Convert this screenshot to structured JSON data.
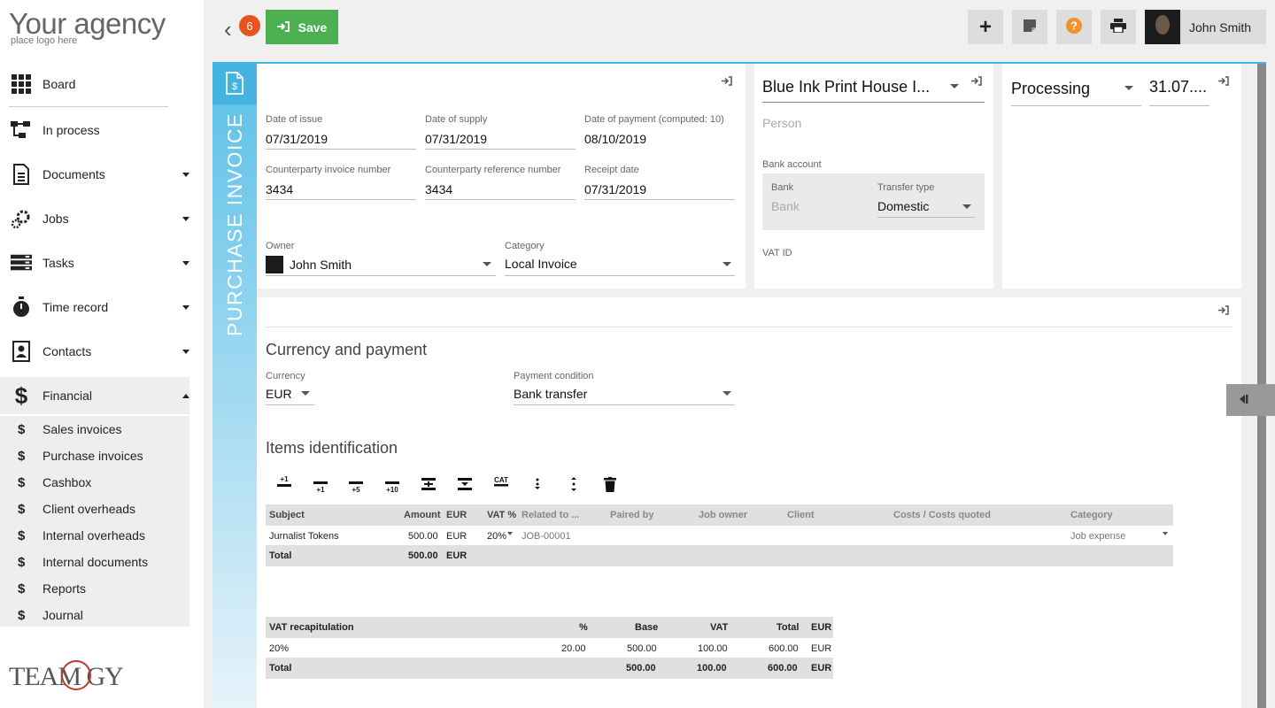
{
  "logo": {
    "main": "Your agency",
    "sub": "place logo here"
  },
  "brand": "TEAM GY",
  "nav": {
    "board": "Board",
    "in_process": "In process",
    "documents": "Documents",
    "jobs": "Jobs",
    "tasks": "Tasks",
    "time_record": "Time record",
    "contacts": "Contacts",
    "financial": "Financial"
  },
  "financial_sub": {
    "sales_invoices": "Sales invoices",
    "purchase_invoices": "Purchase invoices",
    "cashbox": "Cashbox",
    "client_overheads": "Client overheads",
    "internal_overheads": "Internal overheads",
    "internal_documents": "Internal documents",
    "reports": "Reports",
    "journal": "Journal"
  },
  "toolbar": {
    "badge_count": "6",
    "save_label": "Save",
    "user_name": "John Smith"
  },
  "document": {
    "type_title": "PURCHASE INVOICE"
  },
  "dates": {
    "issue_label": "Date of issue",
    "issue_value": "07/31/2019",
    "supply_label": "Date of supply",
    "supply_value": "07/31/2019",
    "payment_label": "Date of payment (computed: 10)",
    "payment_value": "08/10/2019",
    "cp_invoice_label": "Counterparty invoice number",
    "cp_invoice_value": "3434",
    "cp_ref_label": "Counterparty reference number",
    "cp_ref_value": "3434",
    "receipt_label": "Receipt date",
    "receipt_value": "07/31/2019",
    "owner_label": "Owner",
    "owner_value": "John Smith",
    "category_label": "Category",
    "category_value": "Local Invoice"
  },
  "counterparty": {
    "name": "Blue Ink Print House I...",
    "person_placeholder": "Person",
    "bank_account_label": "Bank account",
    "bank_label": "Bank",
    "bank_placeholder": "Bank",
    "transfer_label": "Transfer type",
    "transfer_value": "Domestic",
    "vat_label": "VAT ID"
  },
  "status": {
    "state": "Processing",
    "date": "31.07...."
  },
  "payment": {
    "section_title": "Currency and payment",
    "currency_label": "Currency",
    "currency_value": "EUR",
    "condition_label": "Payment condition",
    "condition_value": "Bank transfer"
  },
  "items": {
    "section_title": "Items identification",
    "tools": [
      "+1",
      "+1",
      "+5",
      "+10",
      "CAT"
    ],
    "headers": {
      "subject": "Subject",
      "amount": "Amount",
      "currency": "EUR",
      "vat": "VAT %",
      "related": "Related to ...",
      "paired": "Paired by",
      "job_owner": "Job owner",
      "client": "Client",
      "costs": "Costs / Costs quoted",
      "category": "Category"
    },
    "row": {
      "subject": "Jurnalist Tokens",
      "amount": "500.00",
      "currency": "EUR",
      "vat": "20%",
      "related": "JOB-00001",
      "category": "Job expense"
    },
    "total": {
      "label": "Total",
      "amount": "500.00",
      "currency": "EUR"
    }
  },
  "vat_recap": {
    "headers": {
      "title": "VAT recapitulation",
      "pct": "%",
      "base": "Base",
      "vat": "VAT",
      "total": "Total",
      "currency": "EUR"
    },
    "row": {
      "rate": "20%",
      "pct": "20.00",
      "base": "500.00",
      "vat": "100.00",
      "total": "600.00",
      "currency": "EUR"
    },
    "total": {
      "label": "Total",
      "base": "500.00",
      "vat": "100.00",
      "total": "600.00",
      "currency": "EUR"
    }
  }
}
